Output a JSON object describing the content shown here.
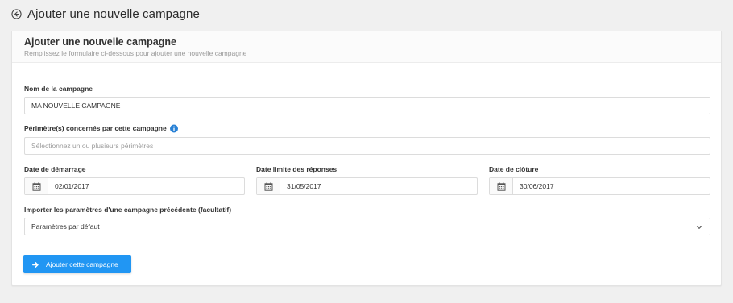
{
  "header": {
    "title": "Ajouter une nouvelle campagne",
    "back_icon": "back-arrow-circle-icon"
  },
  "card": {
    "title": "Ajouter une nouvelle campagne",
    "subtitle": "Remplissez le formulaire ci-dessous pour ajouter une nouvelle campagne"
  },
  "form": {
    "name_label": "Nom de la campagne",
    "name_value": "MA NOUVELLE CAMPAGNE",
    "perimeters_label": "Périmètre(s) concernés par cette campagne",
    "perimeters_placeholder": "Sélectionnez un ou plusieurs périmètres",
    "start_date_label": "Date de démarrage",
    "start_date_value": "02/01/2017",
    "deadline_label": "Date limite des réponses",
    "deadline_value": "31/05/2017",
    "close_date_label": "Date de clôture",
    "close_date_value": "30/06/2017",
    "import_label": "Importer les paramètres d'une campagne précédente (facultatif)",
    "import_selected": "Paramètres par défaut",
    "submit_label": "Ajouter cette campagne"
  },
  "colors": {
    "accent": "#2196f3",
    "info": "#2a82d6",
    "background": "#f0f0f0"
  }
}
